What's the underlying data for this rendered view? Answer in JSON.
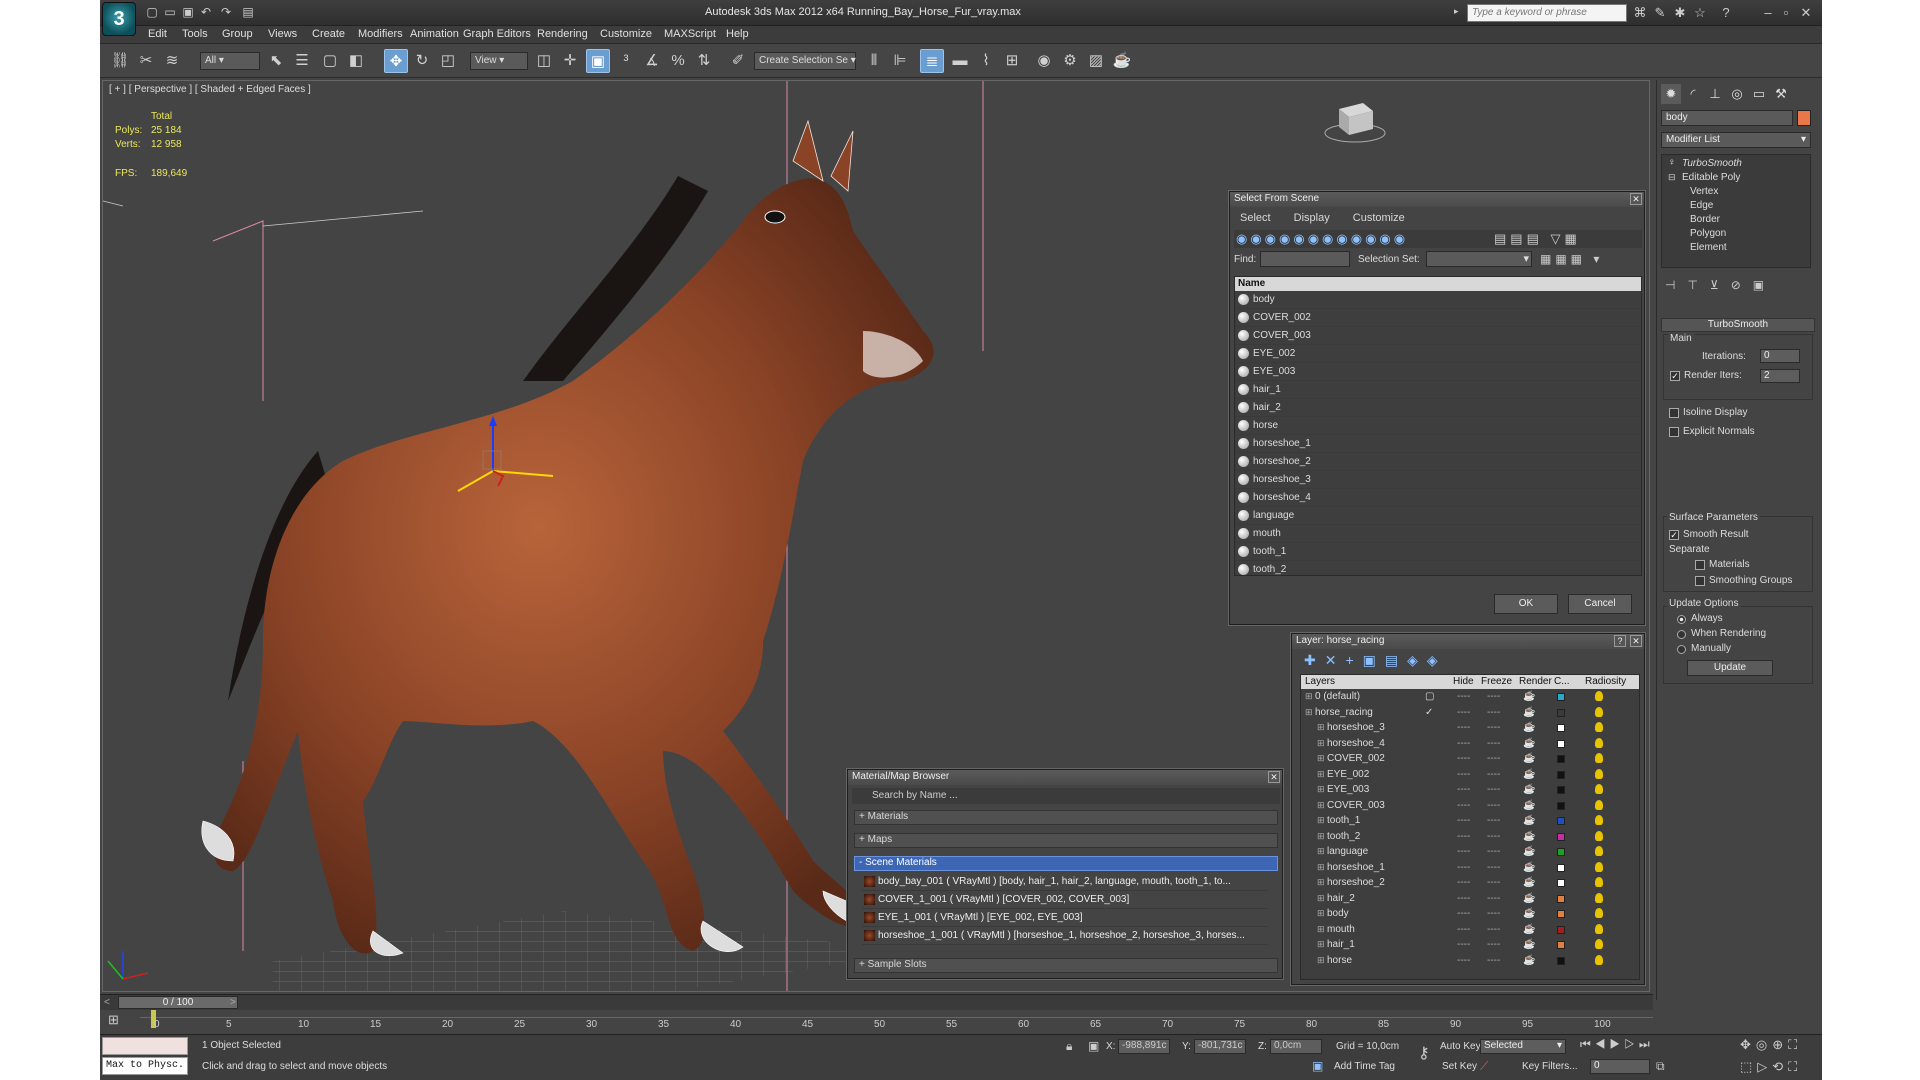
{
  "app": {
    "title": "Autodesk 3ds Max  2012 x64    Running_Bay_Horse_Fur_vray.max",
    "logo": "3",
    "search_placeholder": "Type a keyword or phrase"
  },
  "menu": [
    "Edit",
    "Tools",
    "Group",
    "Views",
    "Create",
    "Modifiers",
    "Animation",
    "Graph Editors",
    "Rendering",
    "Customize",
    "MAXScript",
    "Help"
  ],
  "toolbar": {
    "filter": "All",
    "ref_coord": "View",
    "selection_set": "Create Selection Se"
  },
  "viewport": {
    "label": "[ + ] [ Perspective ] [ Shaded + Edged Faces ]",
    "stats": {
      "total_label": "Total",
      "polys_label": "Polys:",
      "polys": "25 184",
      "verts_label": "Verts:",
      "verts": "12 958",
      "fps_label": "FPS:",
      "fps": "189,649"
    }
  },
  "command_panel": {
    "object_name": "body",
    "object_color": "#e8784a",
    "modifier_list": "Modifier List",
    "stack": [
      "TurboSmooth",
      "Editable Poly",
      "Vertex",
      "Edge",
      "Border",
      "Polygon",
      "Element"
    ],
    "turbosmooth": {
      "header": "TurboSmooth",
      "main": "Main",
      "iterations_label": "Iterations:",
      "iterations": "0",
      "render_iters_label": "Render Iters:",
      "render_iters": "2",
      "isoline": "Isoline Display",
      "explicit_normals": "Explicit Normals",
      "surface_params": "Surface Parameters",
      "smooth_result": "Smooth Result",
      "separate": "Separate",
      "materials": "Materials",
      "smoothing_groups": "Smoothing Groups",
      "update_options": "Update Options",
      "always": "Always",
      "when_rendering": "When Rendering",
      "manually": "Manually",
      "update": "Update"
    }
  },
  "select_from_scene": {
    "title": "Select From Scene",
    "menus": [
      "Select",
      "Display",
      "Customize"
    ],
    "find_label": "Find:",
    "selection_set_label": "Selection Set:",
    "column": "Name",
    "items": [
      "body",
      "COVER_002",
      "COVER_003",
      "EYE_002",
      "EYE_003",
      "hair_1",
      "hair_2",
      "horse",
      "horseshoe_1",
      "horseshoe_2",
      "horseshoe_3",
      "horseshoe_4",
      "language",
      "mouth",
      "tooth_1",
      "tooth_2"
    ],
    "ok": "OK",
    "cancel": "Cancel"
  },
  "layer_dialog": {
    "title": "Layer: horse_racing",
    "columns": [
      "Layers",
      "Hide",
      "Freeze",
      "Render",
      "C...",
      "Radiosity"
    ],
    "rows": [
      {
        "name": "0 (default)",
        "color": "#2aa7c9",
        "indent": 1
      },
      {
        "name": "horse_racing",
        "color": "#3a3a3a",
        "indent": 1
      },
      {
        "name": "horseshoe_3",
        "color": "#ffffff",
        "indent": 2
      },
      {
        "name": "horseshoe_4",
        "color": "#ffffff",
        "indent": 2
      },
      {
        "name": "COVER_002",
        "color": "#111111",
        "indent": 2
      },
      {
        "name": "EYE_002",
        "color": "#111111",
        "indent": 2
      },
      {
        "name": "EYE_003",
        "color": "#111111",
        "indent": 2
      },
      {
        "name": "COVER_003",
        "color": "#111111",
        "indent": 2
      },
      {
        "name": "tooth_1",
        "color": "#2050c0",
        "indent": 2
      },
      {
        "name": "tooth_2",
        "color": "#c030a0",
        "indent": 2
      },
      {
        "name": "language",
        "color": "#20a020",
        "indent": 2
      },
      {
        "name": "horseshoe_1",
        "color": "#ffffff",
        "indent": 2
      },
      {
        "name": "horseshoe_2",
        "color": "#ffffff",
        "indent": 2
      },
      {
        "name": "hair_2",
        "color": "#e08040",
        "indent": 2
      },
      {
        "name": "body",
        "color": "#e08040",
        "indent": 2
      },
      {
        "name": "mouth",
        "color": "#a02020",
        "indent": 2
      },
      {
        "name": "hair_1",
        "color": "#e08040",
        "indent": 2
      },
      {
        "name": "horse",
        "color": "#111111",
        "indent": 2
      }
    ]
  },
  "material_browser": {
    "title": "Material/Map Browser",
    "search": "Search by Name ...",
    "sections": [
      "+ Materials",
      "+ Maps",
      "- Scene Materials",
      "+ Sample Slots"
    ],
    "materials": [
      "body_bay_001  ( VRayMtl ) [body, hair_1, hair_2, language, mouth, tooth_1, to...",
      "COVER_1_001  ( VRayMtl ) [COVER_002, COVER_003]",
      "EYE_1_001  ( VRayMtl ) [EYE_002, EYE_003]",
      "horseshoe_1_001  ( VRayMtl ) [horseshoe_1, horseshoe_2, horseshoe_3, horses..."
    ]
  },
  "timeline": {
    "frame": "0 / 100",
    "ticks": [
      "0",
      "5",
      "10",
      "15",
      "20",
      "25",
      "30",
      "35",
      "40",
      "45",
      "50",
      "55",
      "60",
      "65",
      "70",
      "75",
      "80",
      "85",
      "90",
      "95",
      "100"
    ]
  },
  "status": {
    "script": "Max to Physc.",
    "selected": "1 Object Selected",
    "hint": "Click and drag to select and move objects",
    "x_label": "X:",
    "x": "-988,891c",
    "y_label": "Y:",
    "y": "-801,731c",
    "z_label": "Z:",
    "z": "0,0cm",
    "grid": "Grid = 10,0cm",
    "auto_key": "Auto Key",
    "key_mode": "Selected",
    "set_key": "Set Key",
    "key_filters": "Key Filters...",
    "add_time_tag": "Add Time Tag",
    "current_frame": "0"
  }
}
